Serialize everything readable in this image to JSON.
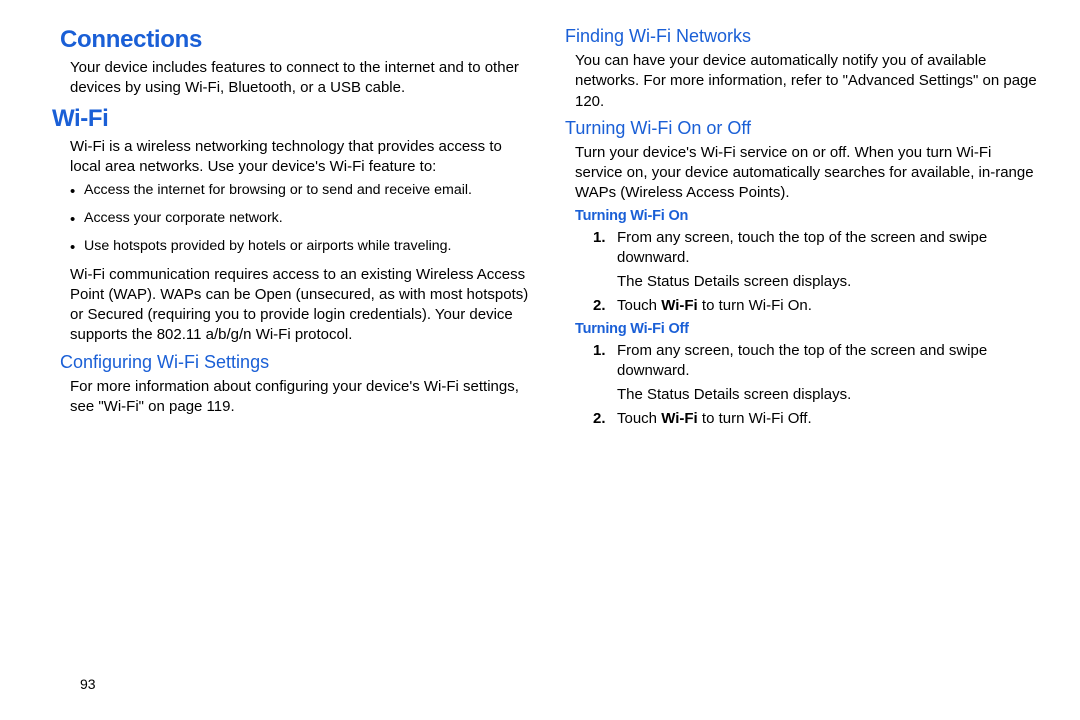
{
  "page_number": "93",
  "left": {
    "h1": "Connections",
    "p1": "Your device includes features to connect to the internet and to other devices by using Wi-Fi, Bluetooth, or a USB cable.",
    "h2": "Wi-Fi",
    "p2": "Wi-Fi is a wireless networking technology that provides access to local area networks. Use your device's Wi-Fi feature to:",
    "bullets": [
      "Access the internet for browsing or to send and receive email.",
      "Access your corporate network.",
      "Use hotspots provided by hotels or airports while traveling."
    ],
    "p3": "Wi-Fi communication requires access to an existing Wireless Access Point (WAP). WAPs can be Open (unsecured, as with most hotspots) or Secured (requiring you to provide login credentials). Your device supports the 802.11 a/b/g/n Wi-Fi protocol.",
    "h3": "Configuring Wi-Fi Settings",
    "p4_a": "For more information about configuring your device's Wi-Fi settings, see ",
    "p4_ref": "\"Wi-Fi\"",
    "p4_b": " on page 119."
  },
  "right": {
    "h3a": "Finding Wi-Fi Networks",
    "p1_a": "You can have your device automatically notify you of available networks. For more information, refer to ",
    "p1_ref": "\"Advanced Settings\"",
    "p1_b": " on page 120.",
    "h3b": "Turning Wi-Fi On or Off",
    "p2": "Turn your device's Wi-Fi service on or off. When you turn Wi-Fi service on, your device automatically searches for available, in-range WAPs (Wireless Access Points).",
    "h4a": "Turning Wi-Fi On",
    "on_steps": {
      "s1": "From any screen, touch the top of the screen and swipe downward.",
      "s1_sub": "The Status Details screen displays.",
      "s2_a": "Touch ",
      "s2_bold": "Wi-Fi",
      "s2_b": " to turn Wi-Fi On."
    },
    "h4b": "Turning Wi-Fi Off",
    "off_steps": {
      "s1": "From any screen, touch the top of the screen and swipe downward.",
      "s1_sub": "The Status Details screen displays.",
      "s2_a": "Touch ",
      "s2_bold": "Wi-Fi",
      "s2_b": " to turn Wi-Fi Off."
    }
  }
}
